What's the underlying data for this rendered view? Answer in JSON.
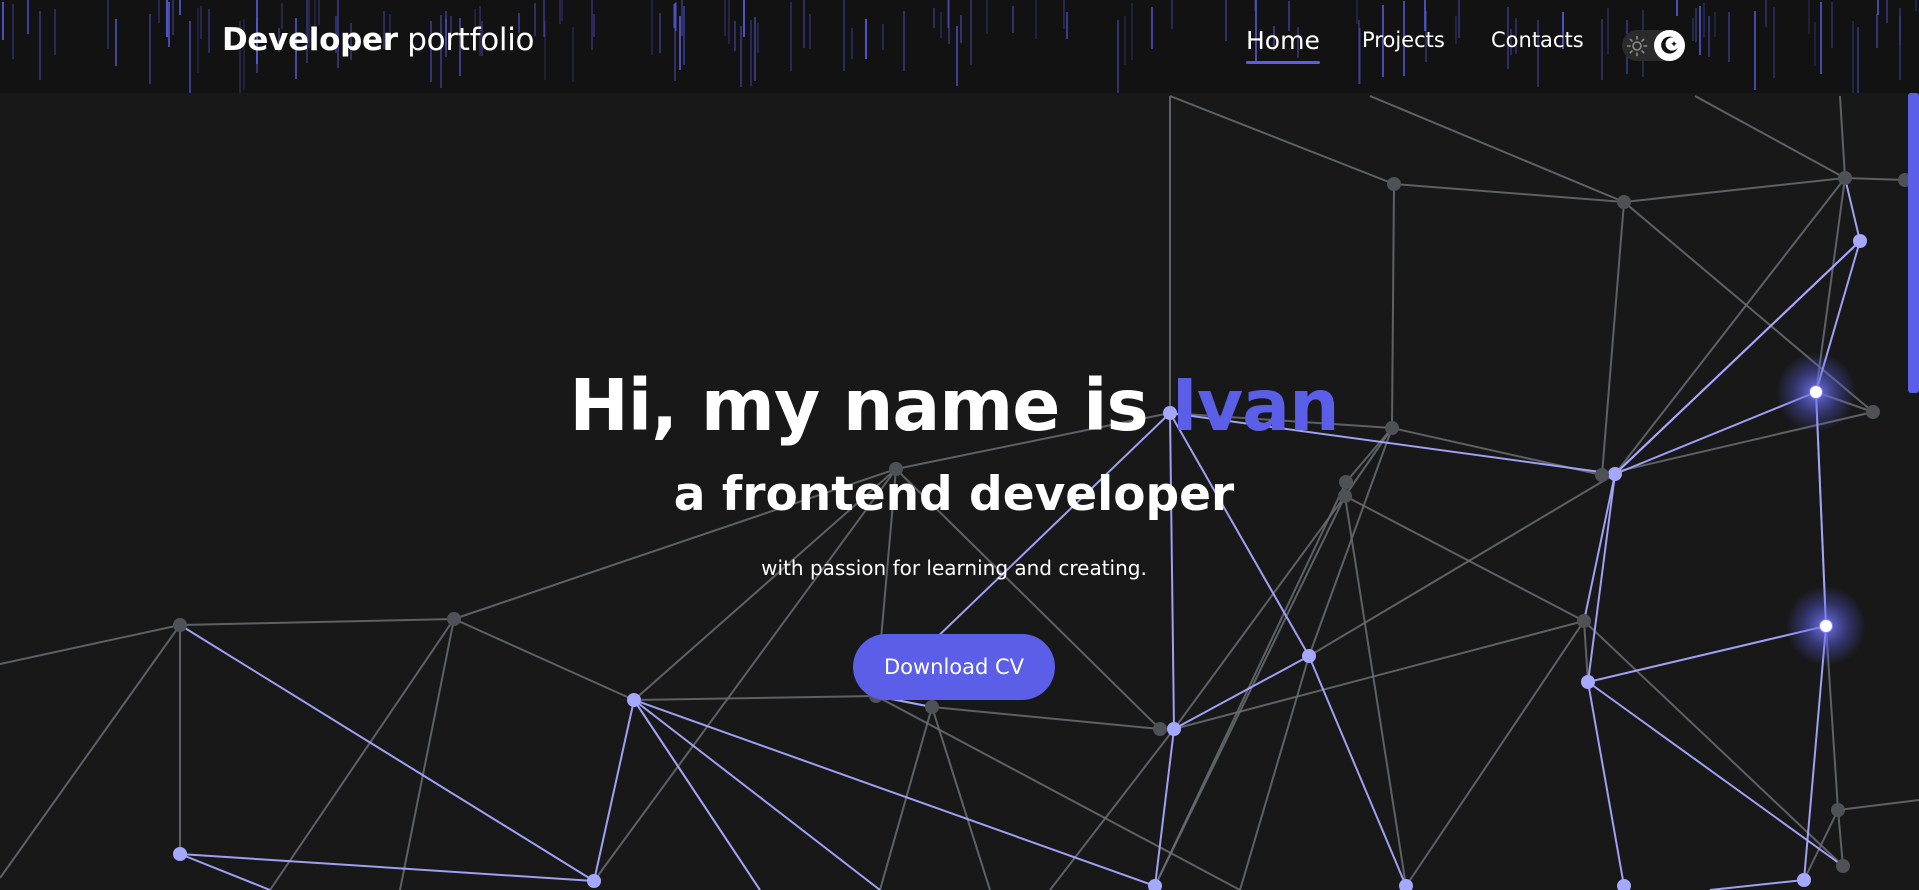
{
  "header": {
    "logo_bold": "Developer",
    "logo_light": "portfolio",
    "nav": [
      {
        "label": "Home",
        "active": true
      },
      {
        "label": "Projects",
        "active": false
      },
      {
        "label": "Contacts",
        "active": false
      }
    ],
    "theme_toggle": {
      "icon_light": "sun-icon",
      "icon_dark": "moon-icon",
      "mode": "dark"
    }
  },
  "hero": {
    "title_prefix": "Hi, my name is",
    "title_name": "Ivan",
    "subtitle": "a frontend developer",
    "tagline": "with passion for learning and creating.",
    "cta_label": "Download CV"
  },
  "colors": {
    "accent": "#5b5ee6",
    "background": "#181818",
    "header_background": "#121212",
    "node_gray": "#4e5257",
    "node_highlight": "#a5a8ff"
  }
}
